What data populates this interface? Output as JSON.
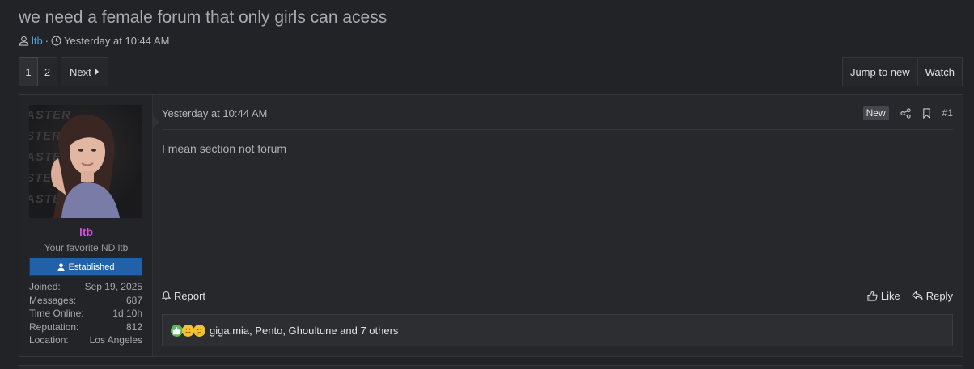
{
  "thread": {
    "title": "we need a female forum that only girls can acess",
    "author": "ltb",
    "separator": "·",
    "date": "Yesterday at 10:44 AM"
  },
  "pagination": {
    "pages": [
      "1",
      "2"
    ],
    "current": "1",
    "next_label": "Next"
  },
  "actions": {
    "jump_label": "Jump to new",
    "watch_label": "Watch"
  },
  "post": {
    "user": {
      "name": "ltb",
      "title": "Your favorite ND ltb",
      "banner": "Established",
      "name_color": "#d24fd6",
      "avatar_text": [
        "ASTER",
        "STER",
        "ASTER",
        "STER",
        "ASTER"
      ],
      "stats": [
        {
          "label": "Joined:",
          "value": "Sep 19, 2025"
        },
        {
          "label": "Messages:",
          "value": "687"
        },
        {
          "label": "Time Online:",
          "value": "1d 10h"
        },
        {
          "label": "Reputation:",
          "value": "812"
        },
        {
          "label": "Location:",
          "value": "Los Angeles"
        }
      ]
    },
    "date": "Yesterday at 10:44 AM",
    "new_badge": "New",
    "number": "#1",
    "body": "I mean section not forum",
    "report_label": "Report",
    "like_label": "Like",
    "reply_label": "Reply",
    "reactions": {
      "icons": [
        "like-reaction-icon",
        "love-reaction-icon",
        "thinking-reaction-icon"
      ],
      "text": "giga.mia, Pento, Ghoultune and 7 others"
    }
  }
}
